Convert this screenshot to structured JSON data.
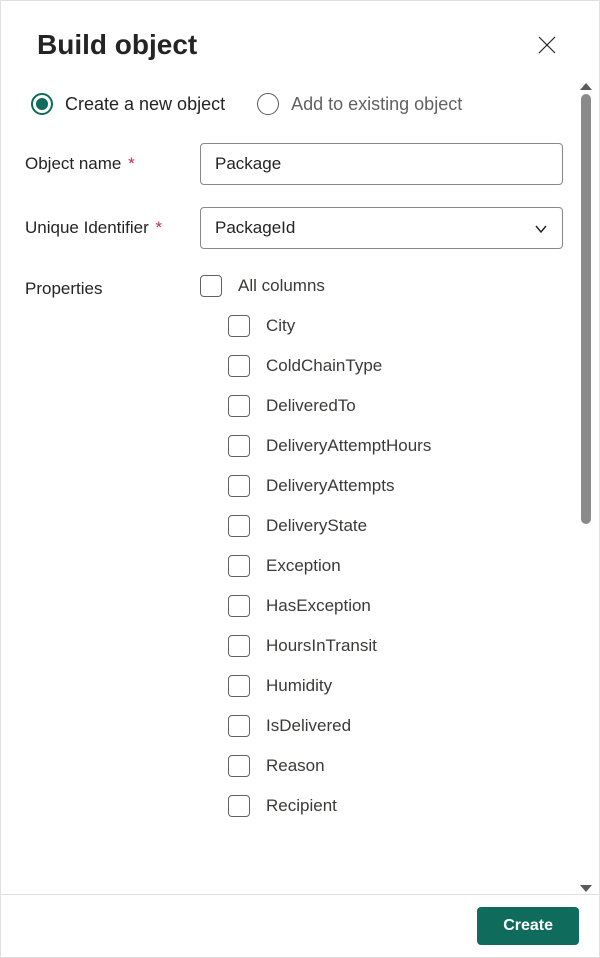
{
  "dialog": {
    "title": "Build object",
    "close_label": "Close"
  },
  "mode": {
    "create_label": "Create a new object",
    "add_label": "Add to existing object",
    "selected": "create"
  },
  "fields": {
    "object_name": {
      "label": "Object name",
      "required": true,
      "value": "Package"
    },
    "unique_identifier": {
      "label": "Unique Identifier",
      "required": true,
      "value": "PackageId"
    },
    "properties": {
      "label": "Properties"
    }
  },
  "properties": {
    "all_label": "All columns",
    "all_checked": false,
    "items": [
      {
        "label": "City",
        "checked": false
      },
      {
        "label": "ColdChainType",
        "checked": false
      },
      {
        "label": "DeliveredTo",
        "checked": false
      },
      {
        "label": "DeliveryAttemptHours",
        "checked": false
      },
      {
        "label": "DeliveryAttempts",
        "checked": false
      },
      {
        "label": "DeliveryState",
        "checked": false
      },
      {
        "label": "Exception",
        "checked": false
      },
      {
        "label": "HasException",
        "checked": false
      },
      {
        "label": "HoursInTransit",
        "checked": false
      },
      {
        "label": "Humidity",
        "checked": false
      },
      {
        "label": "IsDelivered",
        "checked": false
      },
      {
        "label": "Reason",
        "checked": false
      },
      {
        "label": "Recipient",
        "checked": false
      }
    ]
  },
  "footer": {
    "create_label": "Create"
  }
}
